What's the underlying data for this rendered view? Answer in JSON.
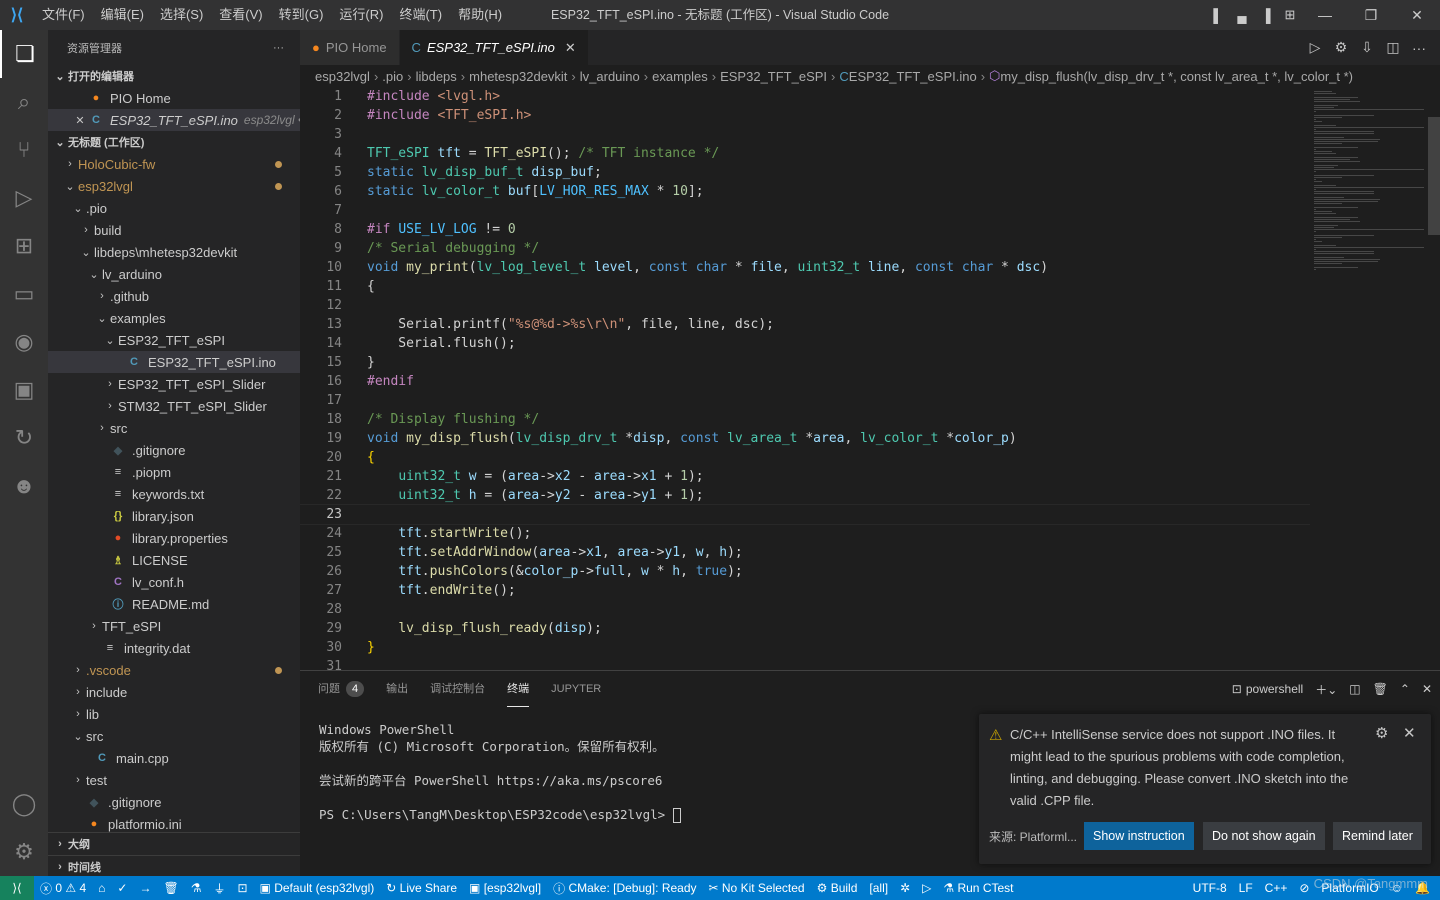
{
  "titlebar": {
    "menu": [
      "文件(F)",
      "编辑(E)",
      "选择(S)",
      "查看(V)",
      "转到(G)",
      "运行(R)",
      "终端(T)",
      "帮助(H)"
    ],
    "title": "ESP32_TFT_eSPI.ino - 无标题 (工作区) - Visual Studio Code"
  },
  "sidebar": {
    "title": "资源管理器",
    "more": "···",
    "open_editors_header": "打开的编辑器",
    "open_editors": [
      {
        "icon": "PIO",
        "label": "PIO Home",
        "extra": ""
      },
      {
        "icon": "C",
        "label": "ESP32_TFT_eSPI.ino",
        "extra": "esp32lvgl • ..."
      }
    ],
    "workspace_header": "无标题 (工作区)",
    "tree": [
      {
        "label": "HoloCubic-fw",
        "chev": "›",
        "indent": 0,
        "color": "#c09553",
        "dot": true
      },
      {
        "label": "esp32lvgl",
        "chev": "⌄",
        "indent": 0,
        "color": "#c09553",
        "dot": true
      },
      {
        "label": ".pio",
        "chev": "⌄",
        "indent": 1
      },
      {
        "label": "build",
        "chev": "›",
        "indent": 2
      },
      {
        "label": "libdeps\\mhetesp32devkit",
        "chev": "⌄",
        "indent": 2
      },
      {
        "label": "lv_arduino",
        "chev": "⌄",
        "indent": 3
      },
      {
        "label": ".github",
        "chev": "›",
        "indent": 4
      },
      {
        "label": "examples",
        "chev": "⌄",
        "indent": 4
      },
      {
        "label": "ESP32_TFT_eSPI",
        "chev": "⌄",
        "indent": 5
      },
      {
        "label": "ESP32_TFT_eSPI.ino",
        "chev": "",
        "indent": 6,
        "icon": "C",
        "iconColor": "#519aba",
        "selected": true
      },
      {
        "label": "ESP32_TFT_eSPI_Slider",
        "chev": "›",
        "indent": 5
      },
      {
        "label": "STM32_TFT_eSPI_Slider",
        "chev": "›",
        "indent": 5
      },
      {
        "label": "src",
        "chev": "›",
        "indent": 4
      },
      {
        "label": ".gitignore",
        "chev": "",
        "indent": 4,
        "icon": "◆",
        "iconColor": "#41535b"
      },
      {
        "label": ".piopm",
        "chev": "",
        "indent": 4,
        "icon": "≡",
        "iconColor": "#cccccc"
      },
      {
        "label": "keywords.txt",
        "chev": "",
        "indent": 4,
        "icon": "≡",
        "iconColor": "#cccccc"
      },
      {
        "label": "library.json",
        "chev": "",
        "indent": 4,
        "icon": "{}",
        "iconColor": "#cbcb41"
      },
      {
        "label": "library.properties",
        "chev": "",
        "indent": 4,
        "icon": "●",
        "iconColor": "#e34c26"
      },
      {
        "label": "LICENSE",
        "chev": "",
        "indent": 4,
        "icon": "♗",
        "iconColor": "#cbcb41"
      },
      {
        "label": "lv_conf.h",
        "chev": "",
        "indent": 4,
        "icon": "C",
        "iconColor": "#a074c4"
      },
      {
        "label": "README.md",
        "chev": "",
        "indent": 4,
        "icon": "ⓘ",
        "iconColor": "#519aba"
      },
      {
        "label": "TFT_eSPI",
        "chev": "›",
        "indent": 3
      },
      {
        "label": "integrity.dat",
        "chev": "",
        "indent": 3,
        "icon": "≡",
        "iconColor": "#cccccc"
      },
      {
        "label": ".vscode",
        "chev": "›",
        "indent": 1,
        "color": "#c09553",
        "dot": true
      },
      {
        "label": "include",
        "chev": "›",
        "indent": 1
      },
      {
        "label": "lib",
        "chev": "›",
        "indent": 1
      },
      {
        "label": "src",
        "chev": "⌄",
        "indent": 1
      },
      {
        "label": "main.cpp",
        "chev": "",
        "indent": 2,
        "icon": "C",
        "iconColor": "#519aba"
      },
      {
        "label": "test",
        "chev": "›",
        "indent": 1
      },
      {
        "label": ".gitignore",
        "chev": "",
        "indent": 1,
        "icon": "◆",
        "iconColor": "#41535b"
      },
      {
        "label": "platformio.ini",
        "chev": "",
        "indent": 1,
        "icon": "●",
        "iconColor": "#f5871f"
      }
    ],
    "outline_header": "大纲",
    "timeline_header": "时间线"
  },
  "tabs": [
    {
      "label": "PIO Home",
      "icon": "●",
      "iconColor": "#f5871f",
      "active": false
    },
    {
      "label": "ESP32_TFT_eSPI.ino",
      "icon": "C",
      "iconColor": "#519aba",
      "active": true,
      "close": "✕"
    }
  ],
  "breadcrumb": [
    "esp32lvgl",
    ".pio",
    "libdeps",
    "mhetesp32devkit",
    "lv_arduino",
    "examples",
    "ESP32_TFT_eSPI",
    "ESP32_TFT_eSPI.ino",
    "my_disp_flush(lv_disp_drv_t *, const lv_area_t *, lv_color_t *)"
  ],
  "editor": {
    "current_line": 23,
    "lines": [
      [
        [
          "k",
          "#include "
        ],
        [
          "s",
          "<lvgl.h>"
        ]
      ],
      [
        [
          "k",
          "#include "
        ],
        [
          "s",
          "<TFT_eSPI.h>"
        ]
      ],
      [],
      [
        [
          "t",
          "TFT_eSPI"
        ],
        [
          "p",
          " "
        ],
        [
          "v",
          "tft"
        ],
        [
          "p",
          " = "
        ],
        [
          "f",
          "TFT_eSPI"
        ],
        [
          "p",
          "(); "
        ],
        [
          "c",
          "/* TFT instance */"
        ]
      ],
      [
        [
          "kb",
          "static"
        ],
        [
          "p",
          " "
        ],
        [
          "t",
          "lv_disp_buf_t"
        ],
        [
          "p",
          " "
        ],
        [
          "v",
          "disp_buf"
        ],
        [
          "p",
          ";"
        ]
      ],
      [
        [
          "kb",
          "static"
        ],
        [
          "p",
          " "
        ],
        [
          "t",
          "lv_color_t"
        ],
        [
          "p",
          " "
        ],
        [
          "v",
          "buf"
        ],
        [
          "p",
          "["
        ],
        [
          "m",
          "LV_HOR_RES_MAX"
        ],
        [
          "p",
          " * "
        ],
        [
          "n",
          "10"
        ],
        [
          "p",
          "];"
        ]
      ],
      [],
      [
        [
          "k",
          "#if"
        ],
        [
          "p",
          " "
        ],
        [
          "m",
          "USE_LV_LOG"
        ],
        [
          "p",
          " != "
        ],
        [
          "n",
          "0"
        ]
      ],
      [
        [
          "c",
          "/* Serial debugging */"
        ]
      ],
      [
        [
          "kb",
          "void"
        ],
        [
          "p",
          " "
        ],
        [
          "f",
          "my_print"
        ],
        [
          "p",
          "("
        ],
        [
          "t",
          "lv_log_level_t"
        ],
        [
          "p",
          " "
        ],
        [
          "v",
          "level"
        ],
        [
          "p",
          ", "
        ],
        [
          "kb",
          "const"
        ],
        [
          "p",
          " "
        ],
        [
          "kb",
          "char"
        ],
        [
          "p",
          " * "
        ],
        [
          "v",
          "file"
        ],
        [
          "p",
          ", "
        ],
        [
          "t",
          "uint32_t"
        ],
        [
          "p",
          " "
        ],
        [
          "v",
          "line"
        ],
        [
          "p",
          ", "
        ],
        [
          "kb",
          "const"
        ],
        [
          "p",
          " "
        ],
        [
          "kb",
          "char"
        ],
        [
          "p",
          " * "
        ],
        [
          "v",
          "dsc"
        ],
        [
          "p",
          ")"
        ]
      ],
      [
        [
          "p",
          "{"
        ]
      ],
      [],
      [
        [
          "p",
          "    Serial.printf("
        ],
        [
          "s",
          "\"%s@%d->%s\\r\\n\""
        ],
        [
          "p",
          ", file, line, dsc);"
        ]
      ],
      [
        [
          "p",
          "    Serial.flush();"
        ]
      ],
      [
        [
          "p",
          "}"
        ]
      ],
      [
        [
          "k",
          "#endif"
        ]
      ],
      [],
      [
        [
          "c",
          "/* Display flushing */"
        ]
      ],
      [
        [
          "kb",
          "void"
        ],
        [
          "p",
          " "
        ],
        [
          "f",
          "my_disp_flush"
        ],
        [
          "p",
          "("
        ],
        [
          "t",
          "lv_disp_drv_t"
        ],
        [
          "p",
          " *"
        ],
        [
          "v",
          "disp"
        ],
        [
          "p",
          ", "
        ],
        [
          "kb",
          "const"
        ],
        [
          "p",
          " "
        ],
        [
          "t",
          "lv_area_t"
        ],
        [
          "p",
          " *"
        ],
        [
          "v",
          "area"
        ],
        [
          "p",
          ", "
        ],
        [
          "t",
          "lv_color_t"
        ],
        [
          "p",
          " *"
        ],
        [
          "v",
          "color_p"
        ],
        [
          "p",
          ")"
        ]
      ],
      [
        [
          "br",
          "{"
        ]
      ],
      [
        [
          "p",
          "    "
        ],
        [
          "t",
          "uint32_t"
        ],
        [
          "p",
          " "
        ],
        [
          "v",
          "w"
        ],
        [
          "p",
          " = ("
        ],
        [
          "v",
          "area"
        ],
        [
          "p",
          "->"
        ],
        [
          "v",
          "x2"
        ],
        [
          "p",
          " - "
        ],
        [
          "v",
          "area"
        ],
        [
          "p",
          "->"
        ],
        [
          "v",
          "x1"
        ],
        [
          "p",
          " + "
        ],
        [
          "n",
          "1"
        ],
        [
          "p",
          ");"
        ]
      ],
      [
        [
          "p",
          "    "
        ],
        [
          "t",
          "uint32_t"
        ],
        [
          "p",
          " "
        ],
        [
          "v",
          "h"
        ],
        [
          "p",
          " = ("
        ],
        [
          "v",
          "area"
        ],
        [
          "p",
          "->"
        ],
        [
          "v",
          "y2"
        ],
        [
          "p",
          " - "
        ],
        [
          "v",
          "area"
        ],
        [
          "p",
          "->"
        ],
        [
          "v",
          "y1"
        ],
        [
          "p",
          " + "
        ],
        [
          "n",
          "1"
        ],
        [
          "p",
          ");"
        ]
      ],
      [],
      [
        [
          "p",
          "    "
        ],
        [
          "v",
          "tft"
        ],
        [
          "p",
          "."
        ],
        [
          "f",
          "startWrite"
        ],
        [
          "p",
          "();"
        ]
      ],
      [
        [
          "p",
          "    "
        ],
        [
          "v",
          "tft"
        ],
        [
          "p",
          "."
        ],
        [
          "f",
          "setAddrWindow"
        ],
        [
          "p",
          "("
        ],
        [
          "v",
          "area"
        ],
        [
          "p",
          "->"
        ],
        [
          "v",
          "x1"
        ],
        [
          "p",
          ", "
        ],
        [
          "v",
          "area"
        ],
        [
          "p",
          "->"
        ],
        [
          "v",
          "y1"
        ],
        [
          "p",
          ", "
        ],
        [
          "v",
          "w"
        ],
        [
          "p",
          ", "
        ],
        [
          "v",
          "h"
        ],
        [
          "p",
          ");"
        ]
      ],
      [
        [
          "p",
          "    "
        ],
        [
          "v",
          "tft"
        ],
        [
          "p",
          "."
        ],
        [
          "f",
          "pushColors"
        ],
        [
          "p",
          "(&"
        ],
        [
          "v",
          "color_p"
        ],
        [
          "p",
          "->"
        ],
        [
          "v",
          "full"
        ],
        [
          "p",
          ", "
        ],
        [
          "v",
          "w"
        ],
        [
          "p",
          " * "
        ],
        [
          "v",
          "h"
        ],
        [
          "p",
          ", "
        ],
        [
          "kb",
          "true"
        ],
        [
          "p",
          ");"
        ]
      ],
      [
        [
          "p",
          "    "
        ],
        [
          "v",
          "tft"
        ],
        [
          "p",
          "."
        ],
        [
          "f",
          "endWrite"
        ],
        [
          "p",
          "();"
        ]
      ],
      [],
      [
        [
          "p",
          "    "
        ],
        [
          "f",
          "lv_disp_flush_ready"
        ],
        [
          "p",
          "("
        ],
        [
          "v",
          "disp"
        ],
        [
          "p",
          ");"
        ]
      ],
      [
        [
          "br",
          "}"
        ]
      ],
      []
    ]
  },
  "panel": {
    "tabs": [
      {
        "label": "问题",
        "badge": "4",
        "active": false
      },
      {
        "label": "输出",
        "active": false
      },
      {
        "label": "调试控制台",
        "active": false
      },
      {
        "label": "终端",
        "active": true
      },
      {
        "label": "JUPYTER",
        "active": false
      }
    ],
    "shell": "powershell",
    "terminal_lines": [
      "Windows PowerShell",
      "版权所有 (C) Microsoft Corporation。保留所有权利。",
      "",
      "尝试新的跨平台 PowerShell https://aka.ms/pscore6",
      "",
      "PS C:\\Users\\TangM\\Desktop\\ESP32code\\esp32lvgl> "
    ]
  },
  "notification": {
    "message": "C/C++ IntelliSense service does not support .INO files. It might lead to the spurious problems with code completion, linting, and debugging. Please convert .INO sketch into the valid .CPP file.",
    "source": "来源: Platforml...",
    "buttons": [
      "Show instruction",
      "Do not show again",
      "Remind later"
    ]
  },
  "statusbar": {
    "errors": "0",
    "warnings": "4",
    "items_left": [
      "Default (esp32lvgl)",
      "Live Share",
      "[esp32lvgl]",
      "CMake: [Debug]: Ready",
      "No Kit Selected",
      "Build",
      "[all]",
      "Run CTest"
    ],
    "items_right": [
      "UTF-8",
      "LF",
      "C++",
      "PlatformIO"
    ],
    "watermark": "CSDN @Tangmmm"
  }
}
